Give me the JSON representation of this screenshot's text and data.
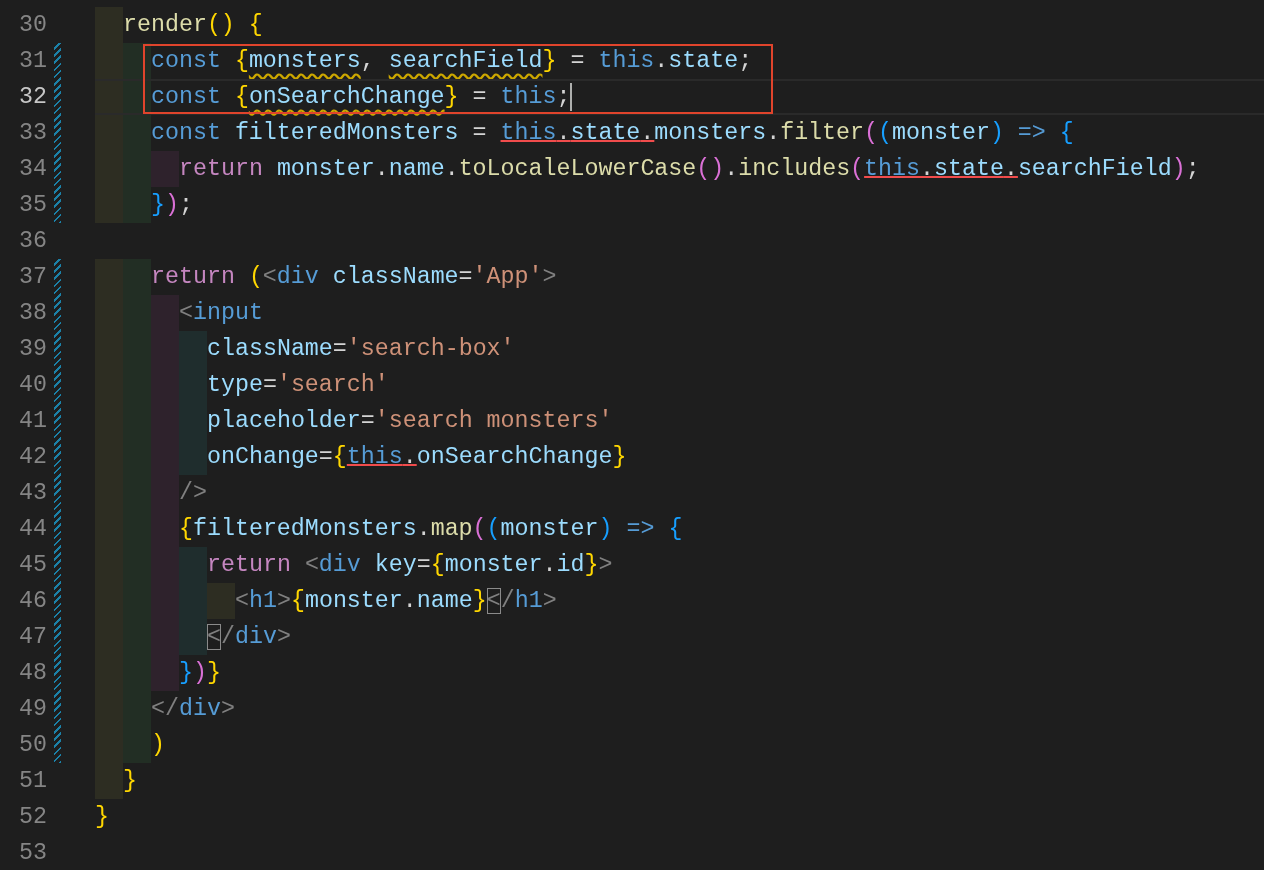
{
  "editor": {
    "lines": [
      {
        "number": "30",
        "modified": false,
        "current": false,
        "boxed": false,
        "tokens": [
          {
            "text": "  render",
            "kind": "fn"
          },
          {
            "text": "() ",
            "kind": "b1"
          },
          {
            "text": "{",
            "kind": "b1"
          }
        ]
      },
      {
        "number": "31",
        "modified": true,
        "current": false,
        "boxed": true,
        "tokens": [
          {
            "text": "    const ",
            "kind": "kw"
          },
          {
            "text": "{",
            "kind": "b1"
          },
          {
            "text": "monsters",
            "kind": "var",
            "squiggle": true
          },
          {
            "text": ", ",
            "kind": "op"
          },
          {
            "text": "searchField",
            "kind": "var",
            "squiggle": true
          },
          {
            "text": "}",
            "kind": "b1"
          },
          {
            "text": " = ",
            "kind": "op"
          },
          {
            "text": "this",
            "kind": "kw"
          },
          {
            "text": ".",
            "kind": "op"
          },
          {
            "text": "state",
            "kind": "var"
          },
          {
            "text": ";",
            "kind": "op"
          }
        ]
      },
      {
        "number": "32",
        "modified": true,
        "current": true,
        "boxed": true,
        "tokens": [
          {
            "text": "    const ",
            "kind": "kw"
          },
          {
            "text": "{",
            "kind": "b1"
          },
          {
            "text": "onSearchChange",
            "kind": "var",
            "squiggle": true
          },
          {
            "text": "}",
            "kind": "b1"
          },
          {
            "text": " = ",
            "kind": "op"
          },
          {
            "text": "this",
            "kind": "kw"
          },
          {
            "text": ";",
            "kind": "op"
          }
        ]
      },
      {
        "number": "33",
        "modified": true,
        "current": false,
        "boxed": false,
        "tokens": [
          {
            "text": "    const ",
            "kind": "kw"
          },
          {
            "text": "filteredMonsters",
            "kind": "var"
          },
          {
            "text": " = ",
            "kind": "op"
          },
          {
            "text": "this",
            "kind": "kw",
            "struck": true
          },
          {
            "text": ".",
            "kind": "op",
            "struck": true
          },
          {
            "text": "state",
            "kind": "var",
            "struck": true
          },
          {
            "text": ".",
            "kind": "op",
            "struck": true
          },
          {
            "text": "monsters",
            "kind": "var"
          },
          {
            "text": ".",
            "kind": "op"
          },
          {
            "text": "filter",
            "kind": "fn"
          },
          {
            "text": "(",
            "kind": "b2"
          },
          {
            "text": "(",
            "kind": "b3"
          },
          {
            "text": "monster",
            "kind": "var"
          },
          {
            "text": ") ",
            "kind": "b3"
          },
          {
            "text": "=> ",
            "kind": "kw"
          },
          {
            "text": "{",
            "kind": "b3"
          }
        ]
      },
      {
        "number": "34",
        "modified": true,
        "current": false,
        "boxed": false,
        "tokens": [
          {
            "text": "      return ",
            "kind": "ctl"
          },
          {
            "text": "monster",
            "kind": "var"
          },
          {
            "text": ".",
            "kind": "op"
          },
          {
            "text": "name",
            "kind": "var"
          },
          {
            "text": ".",
            "kind": "op"
          },
          {
            "text": "toLocaleLowerCase",
            "kind": "fn"
          },
          {
            "text": "()",
            "kind": "b2"
          },
          {
            "text": ".",
            "kind": "op"
          },
          {
            "text": "includes",
            "kind": "fn"
          },
          {
            "text": "(",
            "kind": "b2"
          },
          {
            "text": "this",
            "kind": "kw",
            "struck": true
          },
          {
            "text": ".",
            "kind": "op",
            "struck": true
          },
          {
            "text": "state",
            "kind": "var",
            "struck": true
          },
          {
            "text": ".",
            "kind": "op",
            "struck": true
          },
          {
            "text": "searchField",
            "kind": "var"
          },
          {
            "text": ")",
            "kind": "b2"
          },
          {
            "text": ";",
            "kind": "op"
          }
        ]
      },
      {
        "number": "35",
        "modified": true,
        "current": false,
        "boxed": false,
        "tokens": [
          {
            "text": "    }",
            "kind": "b3"
          },
          {
            "text": ")",
            "kind": "b2"
          },
          {
            "text": ";",
            "kind": "op"
          }
        ]
      },
      {
        "number": "36",
        "modified": false,
        "current": false,
        "boxed": false
      },
      {
        "number": "37",
        "modified": true,
        "current": false,
        "boxed": false,
        "tokens": [
          {
            "text": "    return ",
            "kind": "ctl"
          },
          {
            "text": "(",
            "kind": "b1"
          },
          {
            "text": "<",
            "kind": "tagp"
          },
          {
            "text": "div ",
            "kind": "tag"
          },
          {
            "text": "className",
            "kind": "attr"
          },
          {
            "text": "=",
            "kind": "op"
          },
          {
            "text": "'App'",
            "kind": "str"
          },
          {
            "text": ">",
            "kind": "tagp"
          }
        ]
      },
      {
        "number": "38",
        "modified": true,
        "current": false,
        "boxed": false,
        "tokens": [
          {
            "text": "      <",
            "kind": "tagp"
          },
          {
            "text": "input",
            "kind": "tag"
          }
        ]
      },
      {
        "number": "39",
        "modified": true,
        "current": false,
        "boxed": false,
        "tokens": [
          {
            "text": "        className",
            "kind": "attr"
          },
          {
            "text": "=",
            "kind": "op"
          },
          {
            "text": "'search-box'",
            "kind": "str"
          }
        ]
      },
      {
        "number": "40",
        "modified": true,
        "current": false,
        "boxed": false,
        "tokens": [
          {
            "text": "        type",
            "kind": "attr"
          },
          {
            "text": "=",
            "kind": "op"
          },
          {
            "text": "'search'",
            "kind": "str"
          }
        ]
      },
      {
        "number": "41",
        "modified": true,
        "current": false,
        "boxed": false,
        "tokens": [
          {
            "text": "        placeholder",
            "kind": "attr"
          },
          {
            "text": "=",
            "kind": "op"
          },
          {
            "text": "'search monsters'",
            "kind": "str"
          }
        ]
      },
      {
        "number": "42",
        "modified": true,
        "current": false,
        "boxed": false,
        "tokens": [
          {
            "text": "        onChange",
            "kind": "attr"
          },
          {
            "text": "=",
            "kind": "op"
          },
          {
            "text": "{",
            "kind": "b1"
          },
          {
            "text": "this",
            "kind": "kw",
            "struck": true
          },
          {
            "text": ".",
            "kind": "op",
            "struck": true
          },
          {
            "text": "onSearchChange",
            "kind": "var"
          },
          {
            "text": "}",
            "kind": "b1"
          }
        ]
      },
      {
        "number": "43",
        "modified": true,
        "current": false,
        "boxed": false,
        "tokens": [
          {
            "text": "      />",
            "kind": "tagp"
          }
        ]
      },
      {
        "number": "44",
        "modified": true,
        "current": false,
        "boxed": false,
        "tokens": [
          {
            "text": "      {",
            "kind": "b1"
          },
          {
            "text": "filteredMonsters",
            "kind": "var"
          },
          {
            "text": ".",
            "kind": "op"
          },
          {
            "text": "map",
            "kind": "fn"
          },
          {
            "text": "(",
            "kind": "b2"
          },
          {
            "text": "(",
            "kind": "b3"
          },
          {
            "text": "monster",
            "kind": "var"
          },
          {
            "text": ") ",
            "kind": "b3"
          },
          {
            "text": "=> ",
            "kind": "kw"
          },
          {
            "text": "{",
            "kind": "b3"
          }
        ]
      },
      {
        "number": "45",
        "modified": true,
        "current": false,
        "boxed": false,
        "tokens": [
          {
            "text": "        return ",
            "kind": "ctl"
          },
          {
            "text": "<",
            "kind": "tagp"
          },
          {
            "text": "div ",
            "kind": "tag"
          },
          {
            "text": "key",
            "kind": "attr"
          },
          {
            "text": "=",
            "kind": "op"
          },
          {
            "text": "{",
            "kind": "b1"
          },
          {
            "text": "monster",
            "kind": "var"
          },
          {
            "text": ".",
            "kind": "op"
          },
          {
            "text": "id",
            "kind": "var"
          },
          {
            "text": "}",
            "kind": "b1"
          },
          {
            "text": ">",
            "kind": "tagp"
          }
        ]
      },
      {
        "number": "46",
        "modified": true,
        "current": false,
        "boxed": false,
        "tokens": [
          {
            "text": "          <",
            "kind": "tagp"
          },
          {
            "text": "h1",
            "kind": "tag"
          },
          {
            "text": ">",
            "kind": "tagp"
          },
          {
            "text": "{",
            "kind": "b1"
          },
          {
            "text": "monster",
            "kind": "var"
          },
          {
            "text": ".",
            "kind": "op"
          },
          {
            "text": "name",
            "kind": "var"
          },
          {
            "text": "}",
            "kind": "b1"
          },
          {
            "text": "<",
            "kind": "tagp",
            "matched": true
          },
          {
            "text": "/",
            "kind": "tagp"
          },
          {
            "text": "h1",
            "kind": "tag"
          },
          {
            "text": ">",
            "kind": "tagp"
          }
        ]
      },
      {
        "number": "47",
        "modified": true,
        "current": false,
        "boxed": false,
        "tokens": [
          {
            "text": "        <",
            "kind": "tagp",
            "matched": true
          },
          {
            "text": "/",
            "kind": "tagp"
          },
          {
            "text": "div",
            "kind": "tag"
          },
          {
            "text": ">",
            "kind": "tagp"
          }
        ]
      },
      {
        "number": "48",
        "modified": true,
        "current": false,
        "boxed": false,
        "tokens": [
          {
            "text": "      }",
            "kind": "b3"
          },
          {
            "text": ")",
            "kind": "b2"
          },
          {
            "text": "}",
            "kind": "b1"
          }
        ]
      },
      {
        "number": "49",
        "modified": true,
        "current": false,
        "boxed": false,
        "tokens": [
          {
            "text": "    <",
            "kind": "tagp"
          },
          {
            "text": "/",
            "kind": "tagp"
          },
          {
            "text": "div",
            "kind": "tag"
          },
          {
            "text": ">",
            "kind": "tagp"
          }
        ]
      },
      {
        "number": "50",
        "modified": true,
        "current": false,
        "boxed": false,
        "tokens": [
          {
            "text": "    )",
            "kind": "b1"
          }
        ]
      },
      {
        "number": "51",
        "modified": false,
        "current": false,
        "boxed": false,
        "tokens": [
          {
            "text": "  }",
            "kind": "b1"
          }
        ]
      },
      {
        "number": "52",
        "modified": false,
        "current": false,
        "boxed": false,
        "tokens": [
          {
            "text": "}",
            "kind": "b1"
          }
        ]
      },
      {
        "number": "53",
        "modified": false,
        "current": false,
        "boxed": false
      }
    ]
  }
}
